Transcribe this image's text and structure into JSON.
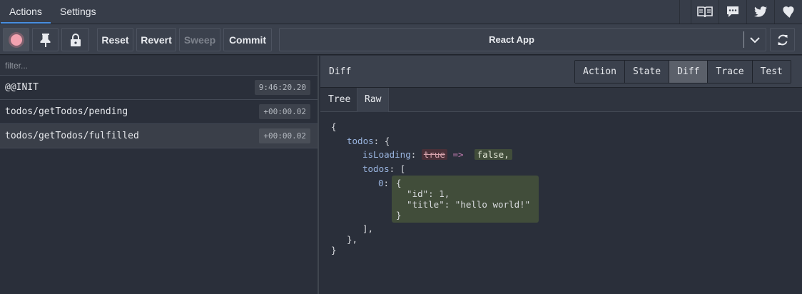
{
  "tabs": {
    "actions": "Actions",
    "settings": "Settings"
  },
  "top_icons": [
    "book-icon",
    "chat-icon",
    "twitter-icon",
    "heart-icon"
  ],
  "toolbar": {
    "reset": "Reset",
    "revert": "Revert",
    "sweep": "Sweep",
    "commit": "Commit",
    "instance": "React App"
  },
  "filter": {
    "placeholder": "filter..."
  },
  "actions": [
    {
      "name": "@@INIT",
      "time": "9:46:20.20"
    },
    {
      "name": "todos/getTodos/pending",
      "time": "+00:00.02"
    },
    {
      "name": "todos/getTodos/fulfilled",
      "time": "+00:00.02"
    }
  ],
  "inspector": {
    "title": "Diff",
    "tabs": [
      "Action",
      "State",
      "Diff",
      "Trace",
      "Test"
    ],
    "active_tab": "Diff",
    "subtabs": [
      "Tree",
      "Raw"
    ],
    "active_subtab": "Raw"
  },
  "diff": {
    "open": "{",
    "todos_key": "todos",
    "isloading_key": "isLoading",
    "old_value": "true",
    "arrow": "=>",
    "new_value": "false,",
    "todos_inner_key": "todos",
    "index_key": "0",
    "added_lines": [
      "{",
      "  \"id\": 1,",
      "  \"title\": \"hello world!\"",
      "}"
    ],
    "close_array": "],",
    "close_obj": "},",
    "close": "}"
  },
  "colors": {
    "accent": "#4a90e2",
    "record": "#f2a2b0",
    "added_bg": "#414d3a",
    "removed_bg": "#4a3038"
  }
}
